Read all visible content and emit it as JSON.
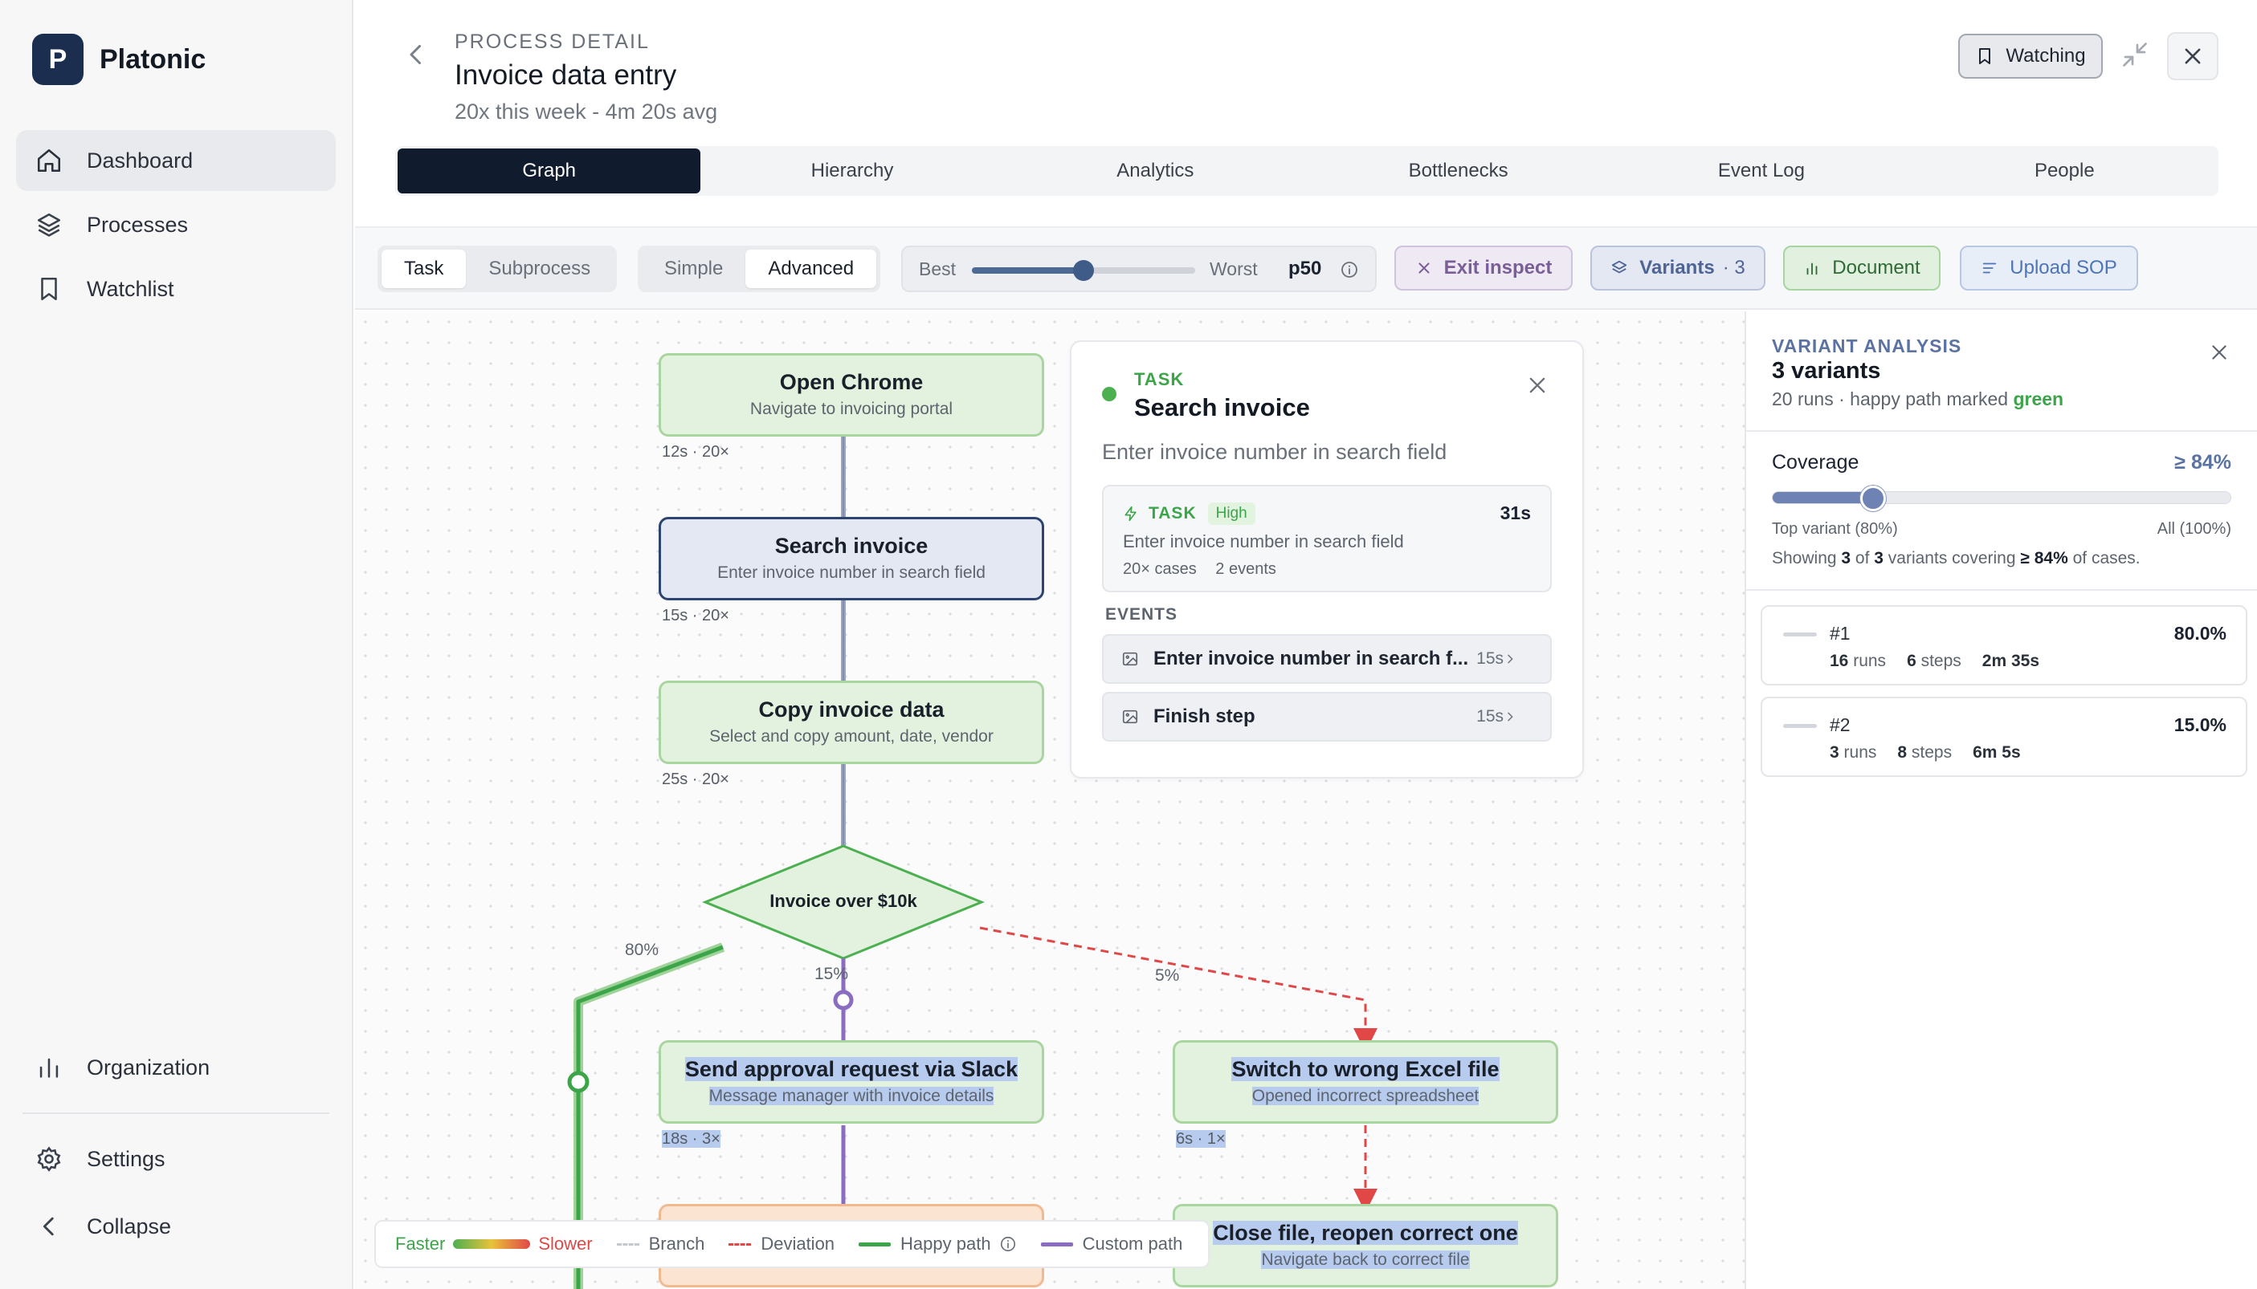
{
  "brand": {
    "logo_letter": "P",
    "name": "Platonic"
  },
  "sidebar": {
    "items": [
      {
        "label": "Dashboard",
        "icon": "home-icon"
      },
      {
        "label": "Processes",
        "icon": "layers-icon"
      },
      {
        "label": "Watchlist",
        "icon": "bookmark-icon"
      }
    ],
    "bottom": [
      {
        "label": "Organization",
        "icon": "bar-chart-icon"
      },
      {
        "label": "Settings",
        "icon": "gear-icon"
      },
      {
        "label": "Collapse",
        "icon": "chevron-left-icon"
      }
    ]
  },
  "header": {
    "crumb": "PROCESS DETAIL",
    "title": "Invoice data entry",
    "subtitle": "20x this week - 4m 20s avg",
    "watch_label": "Watching"
  },
  "tabs": [
    "Graph",
    "Hierarchy",
    "Analytics",
    "Bottlenecks",
    "Event Log",
    "People"
  ],
  "toolbar": {
    "level": [
      "Task",
      "Subprocess"
    ],
    "mode": [
      "Simple",
      "Advanced"
    ],
    "slider": {
      "best": "Best",
      "worst": "Worst",
      "value_label": "p50",
      "position": 0.5
    },
    "exit_inspect": "Exit inspect",
    "variants": "Variants",
    "variants_count": "· 3",
    "document": "Document",
    "upload_sop": "Upload SOP"
  },
  "graph": {
    "nodes": [
      {
        "title": "Open Chrome",
        "sub": "Navigate to invoicing portal",
        "stat": "12s · 20×"
      },
      {
        "title": "Search invoice",
        "sub": "Enter invoice number in search field",
        "stat": "15s · 20×"
      },
      {
        "title": "Copy invoice data",
        "sub": "Select and copy amount, date, vendor",
        "stat": "25s · 20×"
      },
      {
        "title": "Send approval request via Slack",
        "sub": "Message manager with invoice details",
        "stat": "18s · 3×"
      },
      {
        "title": "Switch to wrong Excel file",
        "sub": "Opened incorrect spreadsheet",
        "stat": "6s · 1×"
      },
      {
        "title": "Close file, reopen correct one",
        "sub": "Navigate back to correct file"
      }
    ],
    "decision": "Invoice over $10k",
    "edge_labels": [
      "80%",
      "15%",
      "5%"
    ]
  },
  "detail": {
    "kind": "TASK",
    "name": "Search invoice",
    "description": "Enter invoice number in search field",
    "card": {
      "kind": "TASK",
      "priority": "High",
      "duration": "31s",
      "description": "Enter invoice number in search field",
      "cases": "20× cases",
      "events_count": "2 events"
    },
    "events_heading": "EVENTS",
    "events": [
      {
        "label": "Enter invoice number in search f...",
        "duration": "15s"
      },
      {
        "label": "Finish step",
        "duration": "15s"
      }
    ]
  },
  "legend": {
    "faster": "Faster",
    "slower": "Slower",
    "branch": "Branch",
    "deviation": "Deviation",
    "happy": "Happy path",
    "custom": "Custom path"
  },
  "variant_panel": {
    "kicker": "VARIANT ANALYSIS",
    "title": "3 variants",
    "sub_prefix": "20 runs · happy path marked ",
    "sub_green": "green",
    "coverage_label": "Coverage",
    "coverage_value": "≥ 84%",
    "coverage_position": 0.22,
    "min_label": "Top variant (80%)",
    "max_label": "All (100%)",
    "note_a": "Showing ",
    "note_shown": "3",
    "note_b": " of ",
    "note_total": "3",
    "note_c": " variants covering ",
    "note_pct": "≥ 84%",
    "note_d": " of cases.",
    "variants": [
      {
        "num": "#1",
        "pct": "80.0%",
        "runs": "16",
        "runs_label": "runs",
        "steps": "6",
        "steps_label": "steps",
        "time": "2m 35s"
      },
      {
        "num": "#2",
        "pct": "15.0%",
        "runs": "3",
        "runs_label": "runs",
        "steps": "8",
        "steps_label": "steps",
        "time": "6m 5s"
      }
    ]
  },
  "colors": {
    "accent": "#101b2e",
    "happy": "#3ca54a",
    "deviation": "#e04848",
    "custom": "#8a6cc0"
  }
}
